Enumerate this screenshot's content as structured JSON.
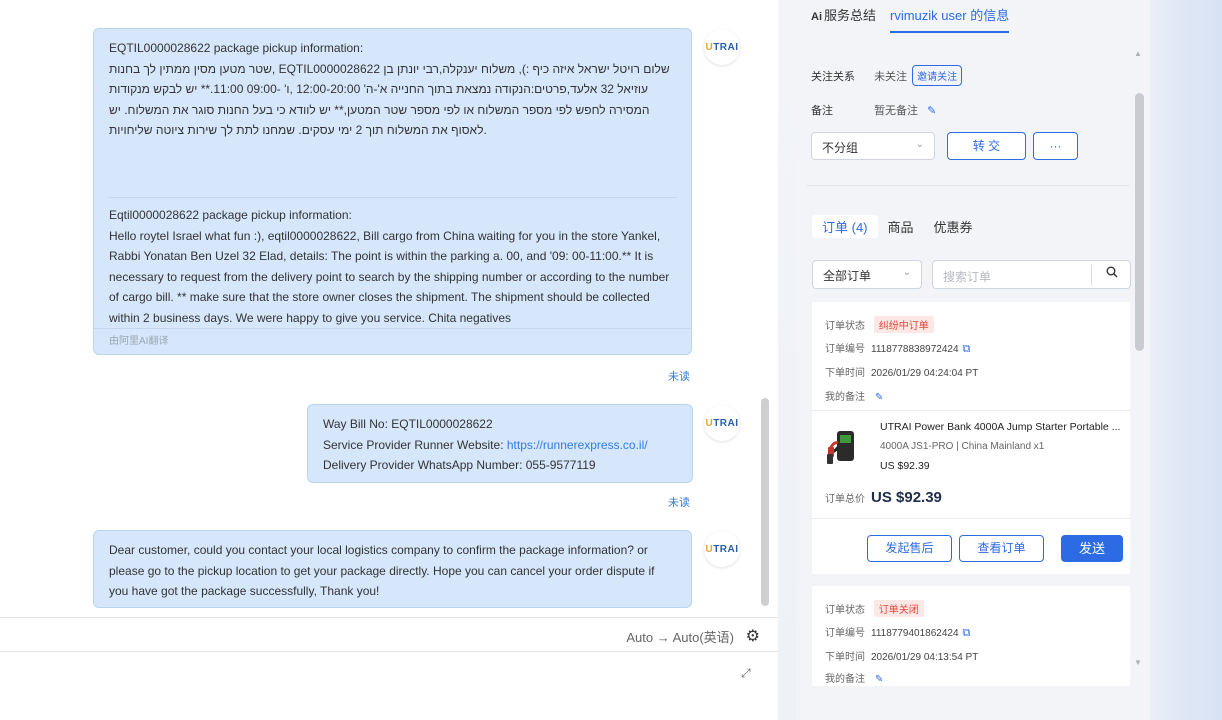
{
  "chat": {
    "avatar_brand": {
      "u": "U",
      "rest": "TRAI"
    },
    "msg1": {
      "header": "EQTIL0000028622 package pickup information:",
      "original_text": "שטר מטען מסין ממתין לך בחנות, EQTIL0000028622 שלום רויטל ישראל איזה כיף :), משלוח יענקלה,רבי יונתן בן עוזיאל 32 אלעד,פרטים:הנקודה נמצאת בתוך החנייה א'-ה' 12:00-20:00 ,ו' -09:00 11:00.** יש לבקש מנקודות המסירה לחפש לפי מספר המשלוח או לפי מספר שטר המטען,** יש לוודא כי בעל החנות סוגר את המשלוח. יש לאסוף את המשלוח תוך 2 ימי עסקים. שמחנו לתת לך שירות ציוטה שליחויות.",
      "trans_header": "Eqtil0000028622 package pickup information:",
      "translated_text": "Hello roytel Israel what fun :), eqtil0000028622, Bill cargo from China waiting for you in the store Yankel, Rabbi Yonatan Ben Uzel 32 Elad, details: The point is within the parking a. 00, and '09: 00-11:00.** It is necessary to request from the delivery point to search by the shipping number or according to the number of cargo bill. ** make sure that the store owner closes the shipment. The shipment should be collected within 2 business days. We were happy to give you service. Chita negatives",
      "footer": "由阿里AI翻译",
      "status": "未读"
    },
    "msg2": {
      "line1": "Way Bill No:  EQTIL0000028622",
      "line2_label": "Service Provider Runner Website: ",
      "line2_link": "https://runnerexpress.co.il/",
      "line3": "Delivery Provider WhatsApp Number: 055-9577119",
      "status": "未读"
    },
    "msg3": {
      "text": "Dear customer, could you contact your local logistics company to confirm the package information? or please go to the pickup location to get your package directly. Hope you can cancel your order dispute if you have got the package successfully, Thank you!"
    },
    "translate_bar": {
      "from": "Auto",
      "arrow": "→",
      "to": "Auto(英语)"
    }
  },
  "panel": {
    "tabs": {
      "summary": "服务总结",
      "summary_ai": "Ai",
      "userinfo": "rvimuzik user 的信息"
    },
    "info": {
      "follow_label": "关注关系",
      "follow_value": "未关注",
      "invite_btn": "邀请关注",
      "note_label": "备注",
      "note_value": "暂无备注",
      "group_select": "不分组",
      "transfer_btn": "转 交",
      "more_btn": "···"
    },
    "order_tabs": {
      "orders": "订单 (4)",
      "products": "商品",
      "coupons": "优惠券"
    },
    "filter": {
      "select": "全部订单",
      "search_placeholder": "搜索订单"
    },
    "order1": {
      "status_label": "订单状态",
      "status": "纠纷中订单",
      "no_label": "订单编号",
      "no": "1118778838972424",
      "time_label": "下单时间",
      "time": "2026/01/29 04:24:04 PT",
      "note_label": "我的备注",
      "product_name": "UTRAI Power Bank 4000A Jump Starter Portable ...",
      "product_spec": "4000A JS1-PRO | China Mainland x1",
      "product_price": "US $92.39",
      "total_label": "订单总价",
      "total": "US $92.39",
      "btn_aftersale": "发起售后",
      "btn_view": "查看订单",
      "btn_send": "发送"
    },
    "order2": {
      "status_label": "订单状态",
      "status": "订单关闭",
      "no_label": "订单编号",
      "no": "1118779401862424",
      "time_label": "下单时间",
      "time": "2026/01/29 04:13:54 PT",
      "note_label": "我的备注"
    }
  },
  "colors": {
    "accent": "#2d6be5",
    "bubble": "#d6e7fb",
    "danger": "#e0453a"
  }
}
